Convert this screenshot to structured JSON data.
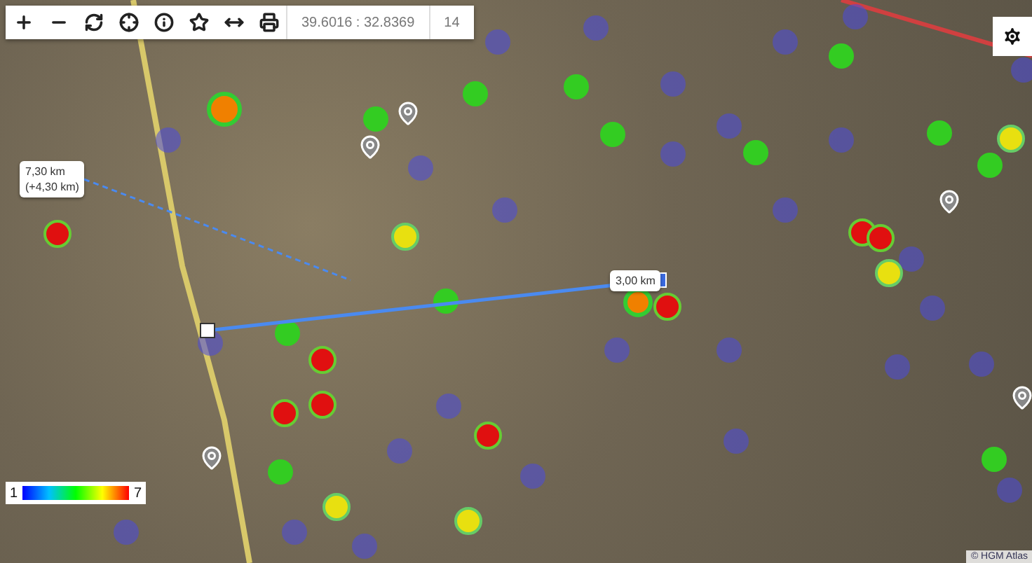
{
  "toolbar": {
    "coordinates": "39.6016 : 32.8369",
    "zoom": "14"
  },
  "measure_labels": [
    {
      "text": "7,30 km",
      "sub": "(+4,30 km)"
    },
    {
      "text": "3,00 km"
    }
  ],
  "legend": {
    "min": "1",
    "max": "7"
  },
  "attribution": "© HGM Atlas"
}
